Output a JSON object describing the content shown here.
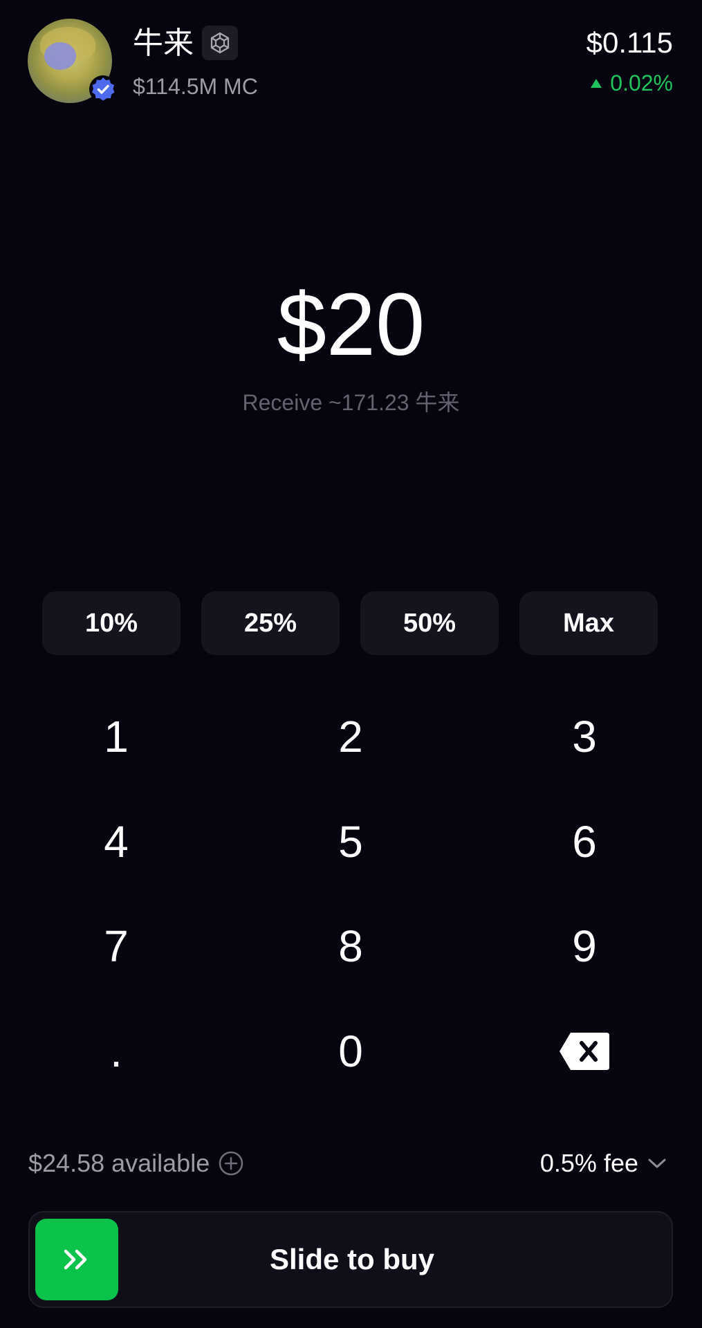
{
  "header": {
    "token_name": "牛来",
    "market_cap": "$114.5M MC",
    "price": "$0.115",
    "change": "0.02%",
    "change_color": "#20c35b",
    "avatar_icon": "token-avatar",
    "verified_icon": "verified-badge-icon",
    "chain_icon": "bnb-chain-icon"
  },
  "trade": {
    "amount": "$20",
    "receive": "Receive ~171.23 牛来"
  },
  "percent_buttons": [
    "10%",
    "25%",
    "50%",
    "Max"
  ],
  "keypad": {
    "keys": [
      "1",
      "2",
      "3",
      "4",
      "5",
      "6",
      "7",
      "8",
      "9",
      ".",
      "0"
    ],
    "backspace_icon": "backspace-icon"
  },
  "footer": {
    "available": "$24.58 available",
    "fee": "0.5% fee",
    "add_icon": "plus-circle-icon",
    "chevron_icon": "chevron-down-icon"
  },
  "slide": {
    "label": "Slide to buy",
    "handle_icon": "double-chevron-right-icon",
    "accent": "#0bc24b"
  }
}
